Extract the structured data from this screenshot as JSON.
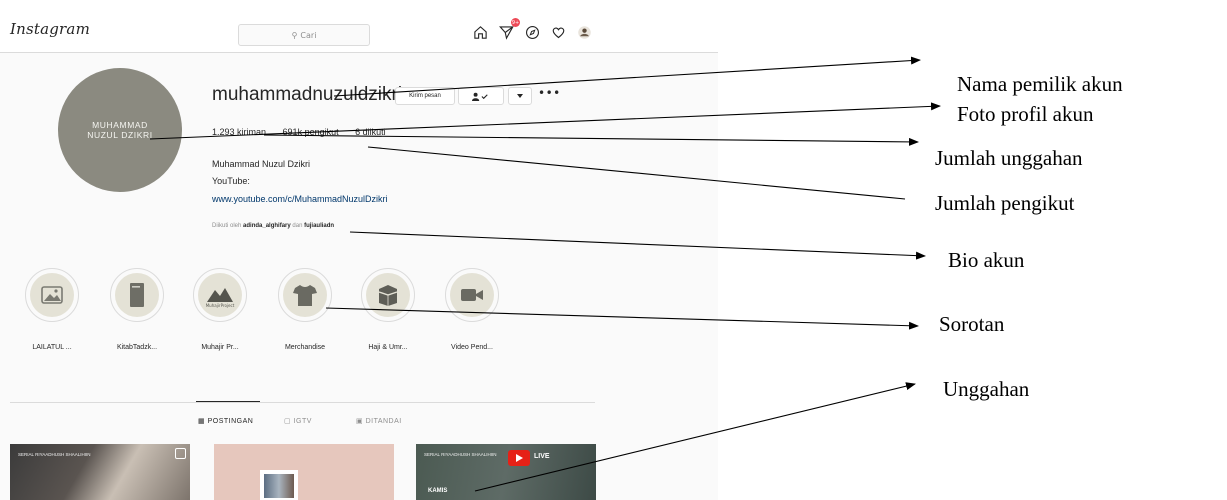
{
  "app": {
    "logo": "Instagram"
  },
  "search": {
    "placeholder": "Cari"
  },
  "nav": {
    "icons": [
      "home-icon",
      "direct-message-icon",
      "explore-icon",
      "activity-heart-icon",
      "profile-avatar-icon"
    ],
    "badge": "9+"
  },
  "profile": {
    "avatar_text": "MUHAMMAD NUZUL DZIKRI",
    "username": "muhammadnuzuldzikri",
    "message_button": "Kirim pesan",
    "follow_button_icon": "person-check-icon",
    "dropdown_icon": "chevron-down-icon",
    "more_icon": "•••",
    "stats": {
      "posts": "1.293 kiriman",
      "followers": "691k pengikut",
      "following": "6 diikuti"
    },
    "full_name": "Muhammad Nuzul Dzikri",
    "bio_line": "YouTube:",
    "bio_link": "www.youtube.com/c/MuhammadNuzulDzikri",
    "followed_by": {
      "prefix": "Diikuti oleh",
      "user1": "adinda_alghifary",
      "conjunction": "dan",
      "user2": "fujiauliadn"
    }
  },
  "highlights": [
    {
      "label": "LAILATUL ...",
      "icon": "image-icon"
    },
    {
      "label": "KitabTadzk...",
      "icon": "book-icon"
    },
    {
      "label": "Muhajir Pr...",
      "icon": "mountain-logo-icon",
      "inner_text": "MuhajirProject"
    },
    {
      "label": "Merchandise",
      "icon": "tshirt-icon"
    },
    {
      "label": "Haji & Umr...",
      "icon": "kaaba-icon"
    },
    {
      "label": "Video Pend...",
      "icon": "video-camera-icon"
    }
  ],
  "tabs": [
    {
      "label": "POSTINGAN",
      "icon": "grid-icon",
      "active": true
    },
    {
      "label": "IGTV",
      "icon": "igtv-icon",
      "active": false
    },
    {
      "label": "DITANDAI",
      "icon": "tagged-icon",
      "active": false
    }
  ],
  "posts": [
    {
      "tag": "SERIAL RIYAADHUSH SHAALIHIIN",
      "label": ""
    },
    {
      "tag": "",
      "label": ""
    },
    {
      "tag": "SERIAL RIYAADHUSH SHAALIHIIN",
      "label": "KAMIS",
      "badge": "LIVE"
    }
  ],
  "annotations": {
    "owner_name": "Nama pemilik akun",
    "profile_photo": "Foto profil akun",
    "post_count": "Jumlah unggahan",
    "follower_count": "Jumlah pengikut",
    "bio": "Bio akun",
    "highlights": "Sorotan",
    "posts": "Unggahan"
  },
  "colors": {
    "accent_link": "#00376b",
    "badge_red": "#ed4956",
    "avatar_bg": "#8b8a80",
    "text": "#262626",
    "muted": "#8e8e8e",
    "live_red": "#e62117"
  }
}
